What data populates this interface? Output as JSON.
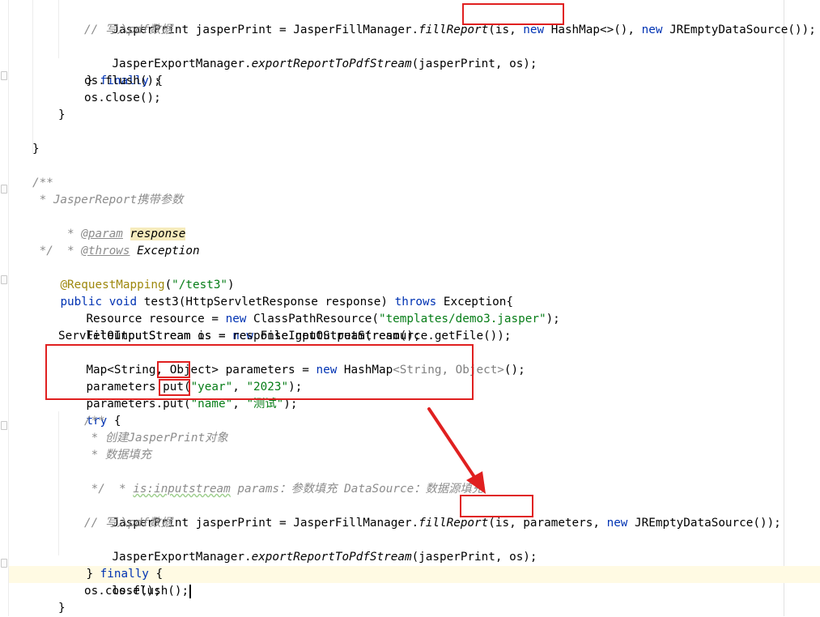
{
  "code": {
    "L1": {
      "t1": "JasperPrint jasperPrint = JasperFillManager.",
      "t2": "fillReport",
      "t3": "(is, ",
      "t4": "new",
      "t5": " HashMap<>()",
      "t6": ", ",
      "t7": "new",
      "t8": " JREmptyDataSource());"
    },
    "L2": {
      "c": "// 写入pdf数据"
    },
    "L3": {
      "t1": "JasperExportManager.",
      "t2": "exportReportToPdfStream",
      "t3": "(jasperPrint, os);"
    },
    "L4": {
      "t1": "} ",
      "t2": "finally",
      "t3": " {"
    },
    "L5": {
      "t": "os.flush();"
    },
    "L6": {
      "t": "os.close();"
    },
    "L7": {
      "t": "}"
    },
    "L9": {
      "t": "}"
    },
    "L11": {
      "c": "/**"
    },
    "L12": {
      "c": " * JasperReport携带参数"
    },
    "L13": {
      "c1": " * ",
      "tag": "@param",
      "c2": " ",
      "pn": "response"
    },
    "L14": {
      "c1": " * ",
      "tag": "@throws",
      "c2": " ",
      "exc": "Exception"
    },
    "L15": {
      "c": " */"
    },
    "L16": {
      "ann": "@RequestMapping",
      "t1": "(",
      "s": "\"/test3\"",
      "t2": ")"
    },
    "L17": {
      "k1": "public void",
      "t1": " test3(HttpServletResponse response) ",
      "k2": "throws",
      "t2": " Exception{"
    },
    "L18": {
      "t1": "Resource resource = ",
      "k": "new",
      "t2": " ClassPathResource(",
      "s": "\"templates/demo3.jasper\"",
      "t3": ");"
    },
    "L19": {
      "t1": "FileInputStream is = ",
      "k": "new",
      "t2": " FileInputStream(resource.getFile());"
    },
    "L20": {
      "t": "ServletOutputStream os = response.getOutputStream();"
    },
    "L21": {
      "t1": "Map<String, Object> parameters = ",
      "k": "new",
      "t2": " HashMap",
      "g": "<String, Object>",
      "t3": "();"
    },
    "L22": {
      "t1": "parameters.put(",
      "s1": "\"year\"",
      "t2": ", ",
      "s2": "\"2023\"",
      "t3": ");"
    },
    "L23": {
      "t1": "parameters.put(",
      "s1": "\"name\"",
      "t2": ", ",
      "s2": "\"测试\"",
      "t3": ");"
    },
    "L24": {
      "k": "try",
      "t": " {"
    },
    "L25": {
      "c": "/**"
    },
    "L26": {
      "c": " * 创建JasperPrint对象"
    },
    "L27": {
      "c": " * 数据填充"
    },
    "L28": {
      "c1": " * ",
      "w": "is:inputstream",
      "c2": " params：参数填充 DataSource：数据源填充"
    },
    "L29": {
      "c": " */"
    },
    "L30": {
      "t1": "JasperPrint jasperPrint = JasperFillManager.",
      "t2": "fillReport",
      "t3": "(is, ",
      "t4": "parameters",
      "t5": ", ",
      "k": "new",
      "t6": " JREmptyDataSource());"
    },
    "L31": {
      "c": "// 写入pdf数据"
    },
    "L32": {
      "t1": "JasperExportManager.",
      "t2": "exportReportToPdfStream",
      "t3": "(jasperPrint, os);"
    },
    "L33": {
      "t1": "} ",
      "t2": "finally",
      "t3": " {"
    },
    "L34": {
      "t": "os.flush();"
    },
    "L35": {
      "t": "os.close();"
    },
    "L36": {
      "t": "}"
    }
  },
  "colors": {
    "keyword": "#0033b3",
    "string": "#067d17",
    "comment": "#8c8c8c",
    "annotation": "#9e880d",
    "highlight_box": "#e02020"
  }
}
